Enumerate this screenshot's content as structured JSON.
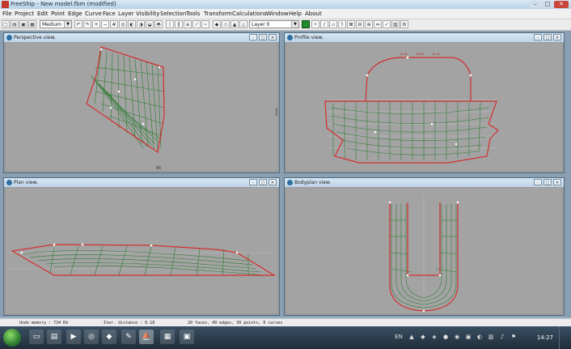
{
  "window": {
    "title": "FreeShip - New model.fbm (modified)",
    "min": "–",
    "max": "□",
    "close": "✕"
  },
  "menu": [
    "File",
    "Project",
    "Edit",
    "Point",
    "Edge",
    "Curve",
    "Face",
    "Layer",
    "Visibility",
    "Selection",
    "Tools",
    "Transform",
    "Calculations",
    "Window",
    "Help",
    "About"
  ],
  "toolbar": {
    "precision": "Medium",
    "layer": "Layer 0",
    "icons": [
      "new-icon",
      "open-icon",
      "save-icon",
      "print-icon",
      "undo-icon",
      "redo-icon",
      "plus-icon",
      "minus-icon",
      "grid-icon",
      "zoom-icon",
      "shade-icon",
      "curvature-icon",
      "control-net-icon",
      "interior-icon",
      "stations-icon",
      "buttocks-icon",
      "waterlines-icon",
      "diagonals-icon",
      "flowlines-icon",
      "markers-icon",
      "hydro-icon",
      "select-all-icon",
      "deselect-icon",
      "new-point-icon",
      "new-edge-icon",
      "new-face-icon",
      "extrude-icon",
      "collapse-icon",
      "insert-plane-icon",
      "intersect-icon",
      "mirror-icon",
      "check-icon",
      "layer-color-icon",
      "layer-icon",
      "tool-icon"
    ]
  },
  "views": {
    "perspective": {
      "title": "Perspective view."
    },
    "profile": {
      "title": "Profile view."
    },
    "plan": {
      "title": "Plan view."
    },
    "bodyplan": {
      "title": "Bodyplan view."
    }
  },
  "status": {
    "memory": "Undo memory : 734 Kb",
    "distance": "Iter. distance : 0.18",
    "counts": "20 faces, 49 edges, 30 points, 0 curves"
  },
  "taskbar": {
    "time": "14:27",
    "lang": "EN"
  },
  "colors": {
    "hull_line": "#2e7d32",
    "outline": "#d32f2f",
    "view_bg": "#a3a3a3"
  }
}
